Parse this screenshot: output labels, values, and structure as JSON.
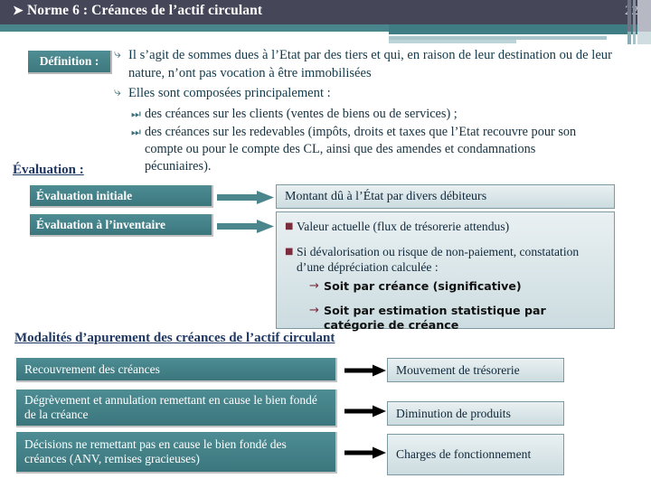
{
  "header": {
    "bullet_icon": "triangle-right-icon",
    "title": "Norme 6 : Créances de l’actif circulant",
    "page_number": "22",
    "bar_color": "#454759",
    "accent_color": "#48868c"
  },
  "definition": {
    "tag_label": "Définition :",
    "bullets": [
      {
        "icon": "curved-arrow-bullet-icon",
        "text": "Il s’agit de sommes dues à l’Etat par des tiers et qui, en raison de leur destination ou de leur nature, n’ont pas vocation à être immobilisées"
      },
      {
        "icon": "curved-arrow-bullet-icon",
        "text": "Elles sont composées principalement :"
      }
    ],
    "sub_bullets": [
      {
        "icon": "double-chevron-icon",
        "text": "des créances sur les clients (ventes de biens ou de services) ;"
      },
      {
        "icon": "double-chevron-icon",
        "text": "des créances sur les redevables (impôts, droits et taxes que l’Etat recouvre pour son compte ou pour le compte des CL, ainsi que des amendes et condamnations pécuniaires)."
      }
    ]
  },
  "evaluation": {
    "heading": "Évaluation :",
    "left_boxes": [
      {
        "label": "Évaluation initiale"
      },
      {
        "label": "Évaluation à l’inventaire"
      }
    ],
    "arrow_icon": "right-arrow-teal-icon",
    "right_panel_1": {
      "text": "Montant dû à l’État par divers débiteurs"
    },
    "right_panel_2": {
      "items": [
        {
          "icon": "square-bullet-icon",
          "text": "Valeur actuelle (flux de trésorerie attendus)"
        },
        {
          "icon": "square-bullet-icon",
          "text": "Si dévalorisation ou risque de non-paiement, constatation d’une dépréciation calculée :"
        }
      ],
      "sub_items": [
        {
          "icon": "arrow-right-icon",
          "text": "Soit par créance (significative)"
        },
        {
          "icon": "arrow-right-icon",
          "text": "Soit par estimation statistique par catégorie de créance"
        }
      ]
    },
    "box_color": "#44838a",
    "panel_color": "#dde8ec"
  },
  "modalites": {
    "heading": "Modalités d’apurement des créances de l’actif circulant",
    "arrow_icon": "right-arrow-black-icon",
    "rows": [
      {
        "source": "Recouvrement des créances",
        "target": "Mouvement de trésorerie"
      },
      {
        "source": "Dégrèvement et annulation remettant en cause le bien fondé de la créance",
        "target": "Diminution de produits"
      },
      {
        "source": "Décisions ne remettant pas en cause le bien fondé des créances (ANV, remises gracieuses)",
        "target": "Charges de fonctionnement"
      }
    ]
  }
}
